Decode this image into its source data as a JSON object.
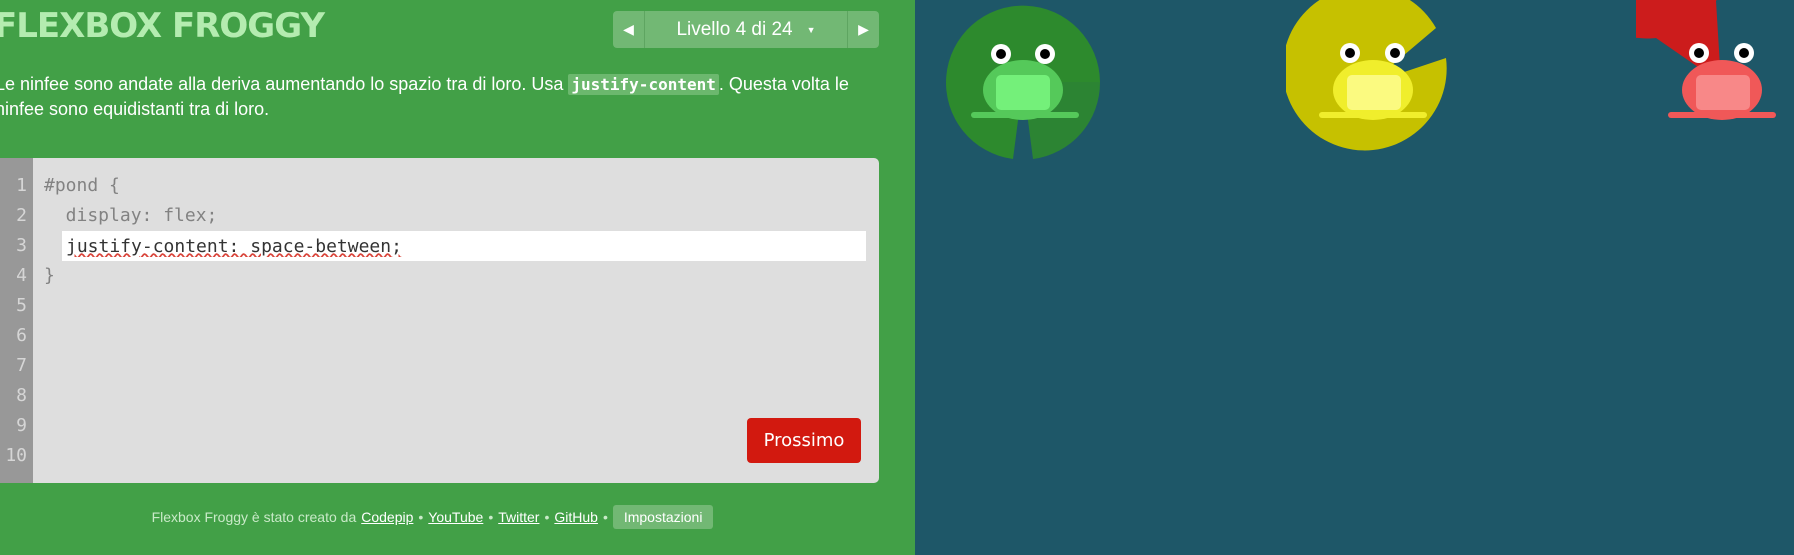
{
  "app": {
    "title": "FLEXBOX FROGGY"
  },
  "level_nav": {
    "label": "Livello 4 di 24"
  },
  "instructions": {
    "before": "Le ninfee sono andate alla deriva aumentando lo spazio tra di loro. Usa ",
    "code": "justify-content",
    "after": ". Questa volta le ninfee sono equidistanti tra di loro."
  },
  "editor": {
    "line_numbers": [
      "1",
      "2",
      "3",
      "4",
      "5",
      "6",
      "7",
      "8",
      "9",
      "10"
    ],
    "line1": "#pond {",
    "line2": "  display: flex;",
    "input_value": "justify-content: space-between;",
    "line4": "}",
    "next_button": "Prossimo"
  },
  "footer": {
    "text": "Flexbox Froggy è stato creato da",
    "links": [
      "Codepip",
      "YouTube",
      "Twitter",
      "GitHub"
    ],
    "separator": "•",
    "settings": "Impostazioni"
  },
  "pond": {
    "lilypads": [
      {
        "color": "green",
        "pad": "#2d8a2d",
        "pad_light": "#3aa03a",
        "frog": "#55c95a",
        "frog_light": "#74f07a"
      },
      {
        "color": "yellow",
        "pad": "#c6c100",
        "pad_light": "#dedb0a",
        "frog": "#f0ee2c",
        "frog_light": "#fbfa80"
      },
      {
        "color": "red",
        "pad": "#cc1c1c",
        "pad_light": "#e52a2a",
        "frog": "#f05858",
        "frog_light": "#f88888"
      }
    ]
  }
}
